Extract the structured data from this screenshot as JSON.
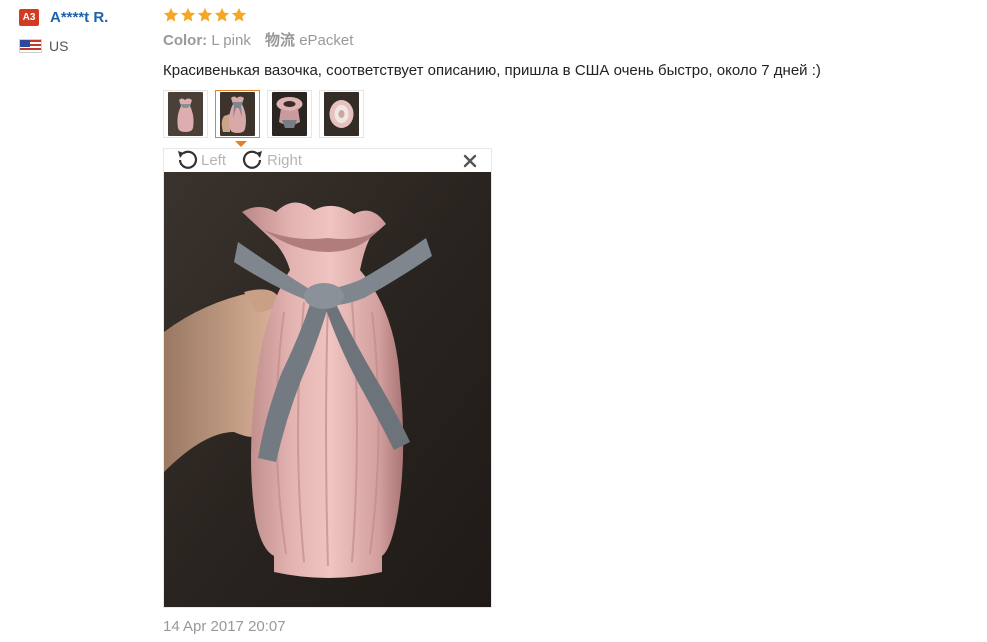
{
  "reviewer": {
    "level_badge": "A3",
    "name": "A****t R.",
    "country": "US",
    "flag_icon": "us-flag-icon"
  },
  "review": {
    "rating": 5,
    "rating_max": 5,
    "star_color": "#f5a623",
    "attributes": [
      {
        "key": "Color:",
        "value": "L pink"
      },
      {
        "key": "物流",
        "value": "ePacket"
      }
    ],
    "text": "Красивенькая вазочка, соответствует описанию, пришла в США очень быстро, около 7 дней :)",
    "date": "14 Apr 2017 20:07"
  },
  "gallery": {
    "thumbnail_count": 4,
    "active_index": 1,
    "accent_color": "#e5802a"
  },
  "viewer": {
    "rotate_left_label": "Left",
    "rotate_right_label": "Right",
    "close_icon": "close-icon"
  }
}
